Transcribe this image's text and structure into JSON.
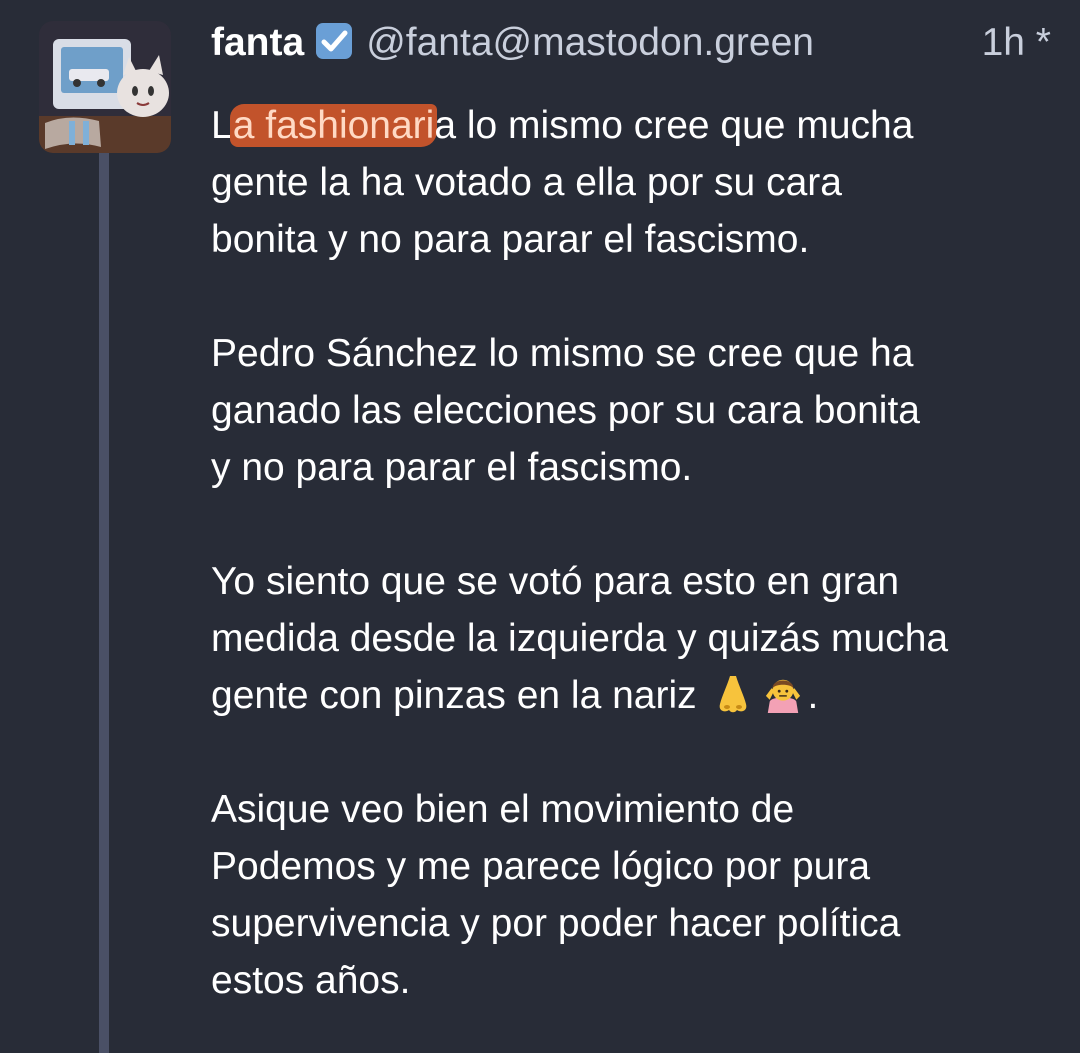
{
  "post": {
    "author": {
      "display_name": "fanta",
      "verified_emoji": "✅",
      "handle": "@fanta@mastodon.green",
      "avatar_icon": "cartoon-cat-at-computer-avatar"
    },
    "timestamp": "1h *",
    "body": {
      "p1": {
        "l1_pre": "L",
        "l1_highlight": "a fashionari",
        "l1_post": "a lo mismo cree que mucha",
        "l2": "gente la ha votado a ella por su cara",
        "l3": "bonita y no para parar el fascismo."
      },
      "p2": {
        "l1": "Pedro Sánchez lo mismo se cree que ha",
        "l2": "ganado las elecciones por su cara bonita",
        "l3": "y no para parar el fascismo."
      },
      "p3": {
        "l1": "Yo siento que se votó para esto en gran",
        "l2": "medida desde la izquierda y quizás mucha",
        "l3_text": "gente con pinzas en la nariz",
        "l3_end": ".",
        "emojis": [
          "nose-emoji",
          "person-shrugging-emoji"
        ]
      },
      "p4": {
        "l1": "Asique veo bien el movimiento de",
        "l2": "Podemos y me parece lógico por pura",
        "l3": "supervivencia y por poder hacer política",
        "l4": "estos años."
      }
    }
  },
  "colors": {
    "background": "#282c37",
    "thread_line": "#4a5066",
    "highlight": "#c2532b",
    "secondary_text": "#c9cfdc"
  }
}
